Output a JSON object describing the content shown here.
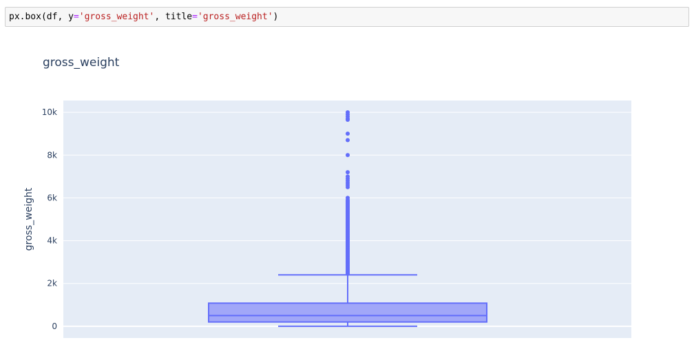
{
  "code_cell": {
    "tokens": [
      {
        "text": "px.box(df, y",
        "kind": "plain"
      },
      {
        "text": "=",
        "kind": "op"
      },
      {
        "text": "'gross_weight'",
        "kind": "str"
      },
      {
        "text": ", title",
        "kind": "plain"
      },
      {
        "text": "=",
        "kind": "op"
      },
      {
        "text": "'gross_weight'",
        "kind": "str"
      },
      {
        "text": ")",
        "kind": "plain"
      }
    ]
  },
  "chart_data": {
    "type": "box",
    "title": "gross_weight",
    "xlabel": "",
    "ylabel": "gross_weight",
    "ylim": [
      -550,
      10550
    ],
    "y_ticks": [
      0,
      2000,
      4000,
      6000,
      8000,
      10000
    ],
    "y_tick_labels": [
      "0",
      "2k",
      "4k",
      "6k",
      "8k",
      "10k"
    ],
    "grid": true,
    "box": {
      "min": 0,
      "q1": 200,
      "median": 500,
      "q3": 1080,
      "upper_fence": 2400
    },
    "outliers": [
      2450,
      2500,
      2550,
      2600,
      2650,
      2700,
      2750,
      2800,
      2850,
      2900,
      2950,
      3000,
      3050,
      3100,
      3150,
      3200,
      3250,
      3300,
      3350,
      3400,
      3450,
      3500,
      3550,
      3600,
      3650,
      3700,
      3750,
      3800,
      3850,
      3900,
      3950,
      4000,
      4050,
      4100,
      4150,
      4200,
      4250,
      4300,
      4350,
      4400,
      4450,
      4500,
      4550,
      4600,
      4650,
      4700,
      4750,
      4800,
      4850,
      4900,
      4950,
      5000,
      5050,
      5100,
      5150,
      5200,
      5250,
      5300,
      5350,
      5400,
      5450,
      5500,
      5550,
      5600,
      5650,
      5700,
      5750,
      5800,
      5850,
      5900,
      6000,
      6500,
      6600,
      6700,
      6800,
      6900,
      7000,
      7200,
      8000,
      8700,
      9000,
      9650,
      9700,
      9800,
      9900,
      10000
    ],
    "colors": {
      "box_line": "#636efa",
      "box_fill": "#a1a7f8",
      "plot_bg": "#e5ecf6",
      "grid": "#ffffff",
      "text": "#2a3f5f"
    }
  }
}
